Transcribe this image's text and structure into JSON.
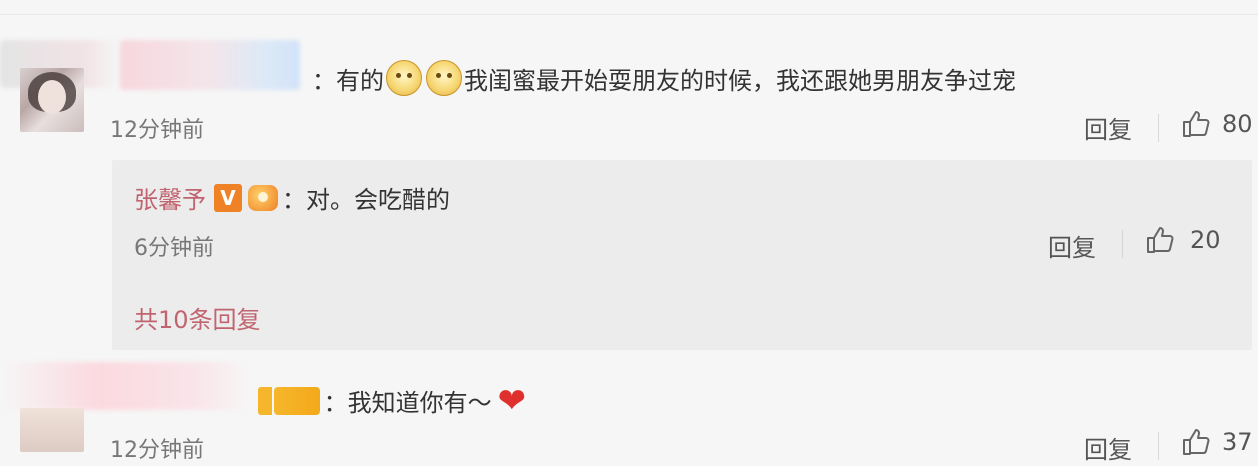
{
  "comments": [
    {
      "text_prefix": "：有的",
      "text_suffix": "我闺蜜最开始耍朋友的时候，我还跟她男朋友争过宠",
      "time": "12分钟前",
      "reply_label": "回复",
      "likes": "80",
      "emoji": [
        "dog-emoji",
        "dog-emoji"
      ]
    },
    {
      "text": "：我知道你有～",
      "time": "12分钟前",
      "reply_label": "回复",
      "likes": "37",
      "emoji": [
        "heart-emoji"
      ]
    }
  ],
  "nested_reply": {
    "user": "张馨予",
    "vip_badge": "V",
    "text": "：对。会吃醋的",
    "time": "6分钟前",
    "reply_label": "回复",
    "likes": "20",
    "total_replies": "共10条回复"
  },
  "colors": {
    "accent_pink": "#c0656f",
    "text_main": "#333333",
    "text_muted": "#777777",
    "background": "#f6f6f6",
    "reply_bg": "#ececec",
    "heart": "#e0302e"
  }
}
